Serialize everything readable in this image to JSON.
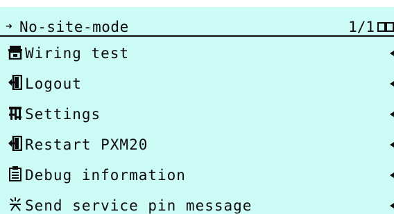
{
  "header": {
    "title": "No-site-mode",
    "page_indicator": "1/1"
  },
  "menu": {
    "items": [
      {
        "label": "Wiring test",
        "icon": "wiring-test-icon"
      },
      {
        "label": "Logout",
        "icon": "logout-icon"
      },
      {
        "label": "Settings",
        "icon": "settings-icon"
      },
      {
        "label": "Restart PXM20",
        "icon": "restart-icon"
      },
      {
        "label": "Debug information",
        "icon": "debug-info-icon"
      },
      {
        "label": "Send service pin message",
        "icon": "service-pin-icon"
      }
    ]
  },
  "colors": {
    "background": "#ccfbf6",
    "foreground": "#0c0c0c"
  }
}
